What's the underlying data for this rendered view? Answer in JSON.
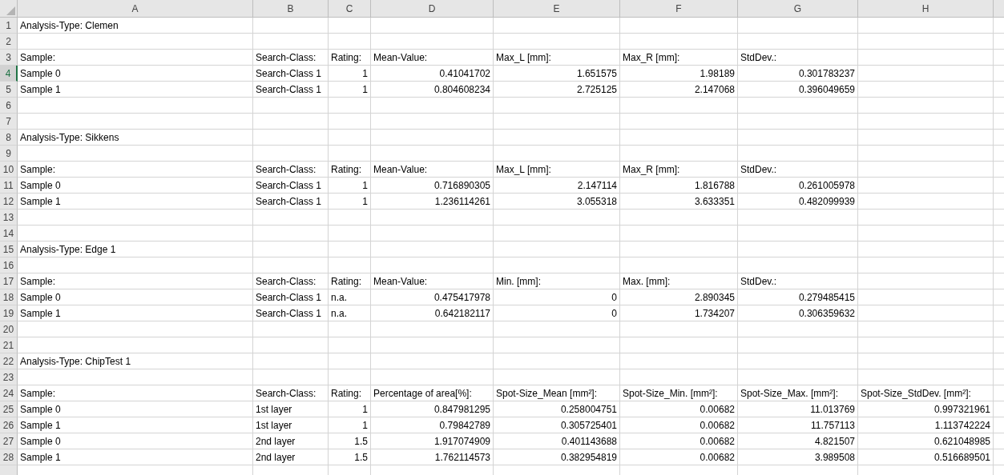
{
  "columns": [
    "A",
    "B",
    "C",
    "D",
    "E",
    "F",
    "G",
    "H"
  ],
  "rows": [
    {
      "number": "1",
      "selected": false,
      "cells": [
        {
          "kind": "text",
          "text": "Analysis-Type: Clemen"
        },
        null,
        null,
        null,
        null,
        null,
        null,
        null
      ]
    },
    {
      "number": "2",
      "selected": false,
      "cells": [
        null,
        null,
        null,
        null,
        null,
        null,
        null,
        null
      ]
    },
    {
      "number": "3",
      "selected": false,
      "cells": [
        {
          "kind": "text",
          "text": "Sample:"
        },
        {
          "kind": "text",
          "text": "Search-Class:"
        },
        {
          "kind": "text",
          "text": "Rating:"
        },
        {
          "kind": "text",
          "text": "Mean-Value:"
        },
        {
          "kind": "text",
          "text": "Max_L [mm]:"
        },
        {
          "kind": "text",
          "text": "Max_R [mm]:"
        },
        {
          "kind": "text",
          "text": "StdDev.:"
        },
        null
      ]
    },
    {
      "number": "4",
      "selected": true,
      "cells": [
        {
          "kind": "text",
          "text": "Sample 0"
        },
        {
          "kind": "text",
          "text": "Search-Class 1"
        },
        {
          "kind": "number",
          "text": "1"
        },
        {
          "kind": "number",
          "text": "0.41041702"
        },
        {
          "kind": "number",
          "text": "1.651575"
        },
        {
          "kind": "number",
          "text": "1.98189"
        },
        {
          "kind": "number",
          "text": "0.301783237"
        },
        null
      ]
    },
    {
      "number": "5",
      "selected": false,
      "cells": [
        {
          "kind": "text",
          "text": "Sample 1"
        },
        {
          "kind": "text",
          "text": "Search-Class 1"
        },
        {
          "kind": "number",
          "text": "1"
        },
        {
          "kind": "number",
          "text": "0.804608234"
        },
        {
          "kind": "number",
          "text": "2.725125"
        },
        {
          "kind": "number",
          "text": "2.147068"
        },
        {
          "kind": "number",
          "text": "0.396049659"
        },
        null
      ]
    },
    {
      "number": "6",
      "selected": false,
      "cells": [
        null,
        null,
        null,
        null,
        null,
        null,
        null,
        null
      ]
    },
    {
      "number": "7",
      "selected": false,
      "cells": [
        null,
        null,
        null,
        null,
        null,
        null,
        null,
        null
      ]
    },
    {
      "number": "8",
      "selected": false,
      "cells": [
        {
          "kind": "text",
          "text": "Analysis-Type: Sikkens"
        },
        null,
        null,
        null,
        null,
        null,
        null,
        null
      ]
    },
    {
      "number": "9",
      "selected": false,
      "cells": [
        null,
        null,
        null,
        null,
        null,
        null,
        null,
        null
      ]
    },
    {
      "number": "10",
      "selected": false,
      "cells": [
        {
          "kind": "text",
          "text": "Sample:"
        },
        {
          "kind": "text",
          "text": "Search-Class:"
        },
        {
          "kind": "text",
          "text": "Rating:"
        },
        {
          "kind": "text",
          "text": "Mean-Value:"
        },
        {
          "kind": "text",
          "text": "Max_L [mm]:"
        },
        {
          "kind": "text",
          "text": "Max_R [mm]:"
        },
        {
          "kind": "text",
          "text": "StdDev.:"
        },
        null
      ]
    },
    {
      "number": "11",
      "selected": false,
      "cells": [
        {
          "kind": "text",
          "text": "Sample 0"
        },
        {
          "kind": "text",
          "text": "Search-Class 1"
        },
        {
          "kind": "number",
          "text": "1"
        },
        {
          "kind": "number",
          "text": "0.716890305"
        },
        {
          "kind": "number",
          "text": "2.147114"
        },
        {
          "kind": "number",
          "text": "1.816788"
        },
        {
          "kind": "number",
          "text": "0.261005978"
        },
        null
      ]
    },
    {
      "number": "12",
      "selected": false,
      "cells": [
        {
          "kind": "text",
          "text": "Sample 1"
        },
        {
          "kind": "text",
          "text": "Search-Class 1"
        },
        {
          "kind": "number",
          "text": "1"
        },
        {
          "kind": "number",
          "text": "1.236114261"
        },
        {
          "kind": "number",
          "text": "3.055318"
        },
        {
          "kind": "number",
          "text": "3.633351"
        },
        {
          "kind": "number",
          "text": "0.482099939"
        },
        null
      ]
    },
    {
      "number": "13",
      "selected": false,
      "cells": [
        null,
        null,
        null,
        null,
        null,
        null,
        null,
        null
      ]
    },
    {
      "number": "14",
      "selected": false,
      "cells": [
        null,
        null,
        null,
        null,
        null,
        null,
        null,
        null
      ]
    },
    {
      "number": "15",
      "selected": false,
      "cells": [
        {
          "kind": "text",
          "text": "Analysis-Type: Edge 1"
        },
        null,
        null,
        null,
        null,
        null,
        null,
        null
      ]
    },
    {
      "number": "16",
      "selected": false,
      "cells": [
        null,
        null,
        null,
        null,
        null,
        null,
        null,
        null
      ]
    },
    {
      "number": "17",
      "selected": false,
      "cells": [
        {
          "kind": "text",
          "text": "Sample:"
        },
        {
          "kind": "text",
          "text": "Search-Class:"
        },
        {
          "kind": "text",
          "text": "Rating:"
        },
        {
          "kind": "text",
          "text": "Mean-Value:"
        },
        {
          "kind": "text",
          "text": "Min. [mm]:"
        },
        {
          "kind": "text",
          "text": "Max. [mm]:"
        },
        {
          "kind": "text",
          "text": "StdDev.:"
        },
        null
      ]
    },
    {
      "number": "18",
      "selected": false,
      "cells": [
        {
          "kind": "text",
          "text": "Sample 0"
        },
        {
          "kind": "text",
          "text": "Search-Class 1"
        },
        {
          "kind": "text",
          "text": "n.a."
        },
        {
          "kind": "number",
          "text": "0.475417978"
        },
        {
          "kind": "number",
          "text": "0"
        },
        {
          "kind": "number",
          "text": "2.890345"
        },
        {
          "kind": "number",
          "text": "0.279485415"
        },
        null
      ]
    },
    {
      "number": "19",
      "selected": false,
      "cells": [
        {
          "kind": "text",
          "text": "Sample 1"
        },
        {
          "kind": "text",
          "text": "Search-Class 1"
        },
        {
          "kind": "text",
          "text": "n.a."
        },
        {
          "kind": "number",
          "text": "0.642182117"
        },
        {
          "kind": "number",
          "text": "0"
        },
        {
          "kind": "number",
          "text": "1.734207"
        },
        {
          "kind": "number",
          "text": "0.306359632"
        },
        null
      ]
    },
    {
      "number": "20",
      "selected": false,
      "cells": [
        null,
        null,
        null,
        null,
        null,
        null,
        null,
        null
      ]
    },
    {
      "number": "21",
      "selected": false,
      "cells": [
        null,
        null,
        null,
        null,
        null,
        null,
        null,
        null
      ]
    },
    {
      "number": "22",
      "selected": false,
      "cells": [
        {
          "kind": "text",
          "text": "Analysis-Type: ChipTest 1"
        },
        null,
        null,
        null,
        null,
        null,
        null,
        null
      ]
    },
    {
      "number": "23",
      "selected": false,
      "cells": [
        null,
        null,
        null,
        null,
        null,
        null,
        null,
        null
      ]
    },
    {
      "number": "24",
      "selected": false,
      "cells": [
        {
          "kind": "text",
          "text": "Sample:"
        },
        {
          "kind": "text",
          "text": "Search-Class:"
        },
        {
          "kind": "text",
          "text": "Rating:"
        },
        {
          "kind": "text",
          "text": "Percentage of area[%]:"
        },
        {
          "kind": "text",
          "text": "Spot-Size_Mean [mm²]:"
        },
        {
          "kind": "text",
          "text": "Spot-Size_Min. [mm²]:"
        },
        {
          "kind": "text",
          "text": "Spot-Size_Max. [mm²]:"
        },
        {
          "kind": "text",
          "text": "Spot-Size_StdDev. [mm²]:"
        }
      ]
    },
    {
      "number": "25",
      "selected": false,
      "cells": [
        {
          "kind": "text",
          "text": "Sample 0"
        },
        {
          "kind": "text",
          "text": "1st layer"
        },
        {
          "kind": "number",
          "text": "1"
        },
        {
          "kind": "number",
          "text": "0.847981295"
        },
        {
          "kind": "number",
          "text": "0.258004751"
        },
        {
          "kind": "number",
          "text": "0.00682"
        },
        {
          "kind": "number",
          "text": "11.013769"
        },
        {
          "kind": "number",
          "text": "0.997321961"
        }
      ]
    },
    {
      "number": "26",
      "selected": false,
      "cells": [
        {
          "kind": "text",
          "text": "Sample 1"
        },
        {
          "kind": "text",
          "text": "1st layer"
        },
        {
          "kind": "number",
          "text": "1"
        },
        {
          "kind": "number",
          "text": "0.79842789"
        },
        {
          "kind": "number",
          "text": "0.305725401"
        },
        {
          "kind": "number",
          "text": "0.00682"
        },
        {
          "kind": "number",
          "text": "11.757113"
        },
        {
          "kind": "number",
          "text": "1.113742224"
        }
      ]
    },
    {
      "number": "27",
      "selected": false,
      "cells": [
        {
          "kind": "text",
          "text": "Sample 0"
        },
        {
          "kind": "text",
          "text": "2nd layer"
        },
        {
          "kind": "number",
          "text": "1.5"
        },
        {
          "kind": "number",
          "text": "1.917074909"
        },
        {
          "kind": "number",
          "text": "0.401143688"
        },
        {
          "kind": "number",
          "text": "0.00682"
        },
        {
          "kind": "number",
          "text": "4.821507"
        },
        {
          "kind": "number",
          "text": "0.621048985"
        }
      ]
    },
    {
      "number": "28",
      "selected": false,
      "cells": [
        {
          "kind": "text",
          "text": "Sample 1"
        },
        {
          "kind": "text",
          "text": "2nd layer"
        },
        {
          "kind": "number",
          "text": "1.5"
        },
        {
          "kind": "number",
          "text": "1.762114573"
        },
        {
          "kind": "number",
          "text": "0.382954819"
        },
        {
          "kind": "number",
          "text": "0.00682"
        },
        {
          "kind": "number",
          "text": "3.989508"
        },
        {
          "kind": "number",
          "text": "0.516689501"
        }
      ]
    }
  ]
}
